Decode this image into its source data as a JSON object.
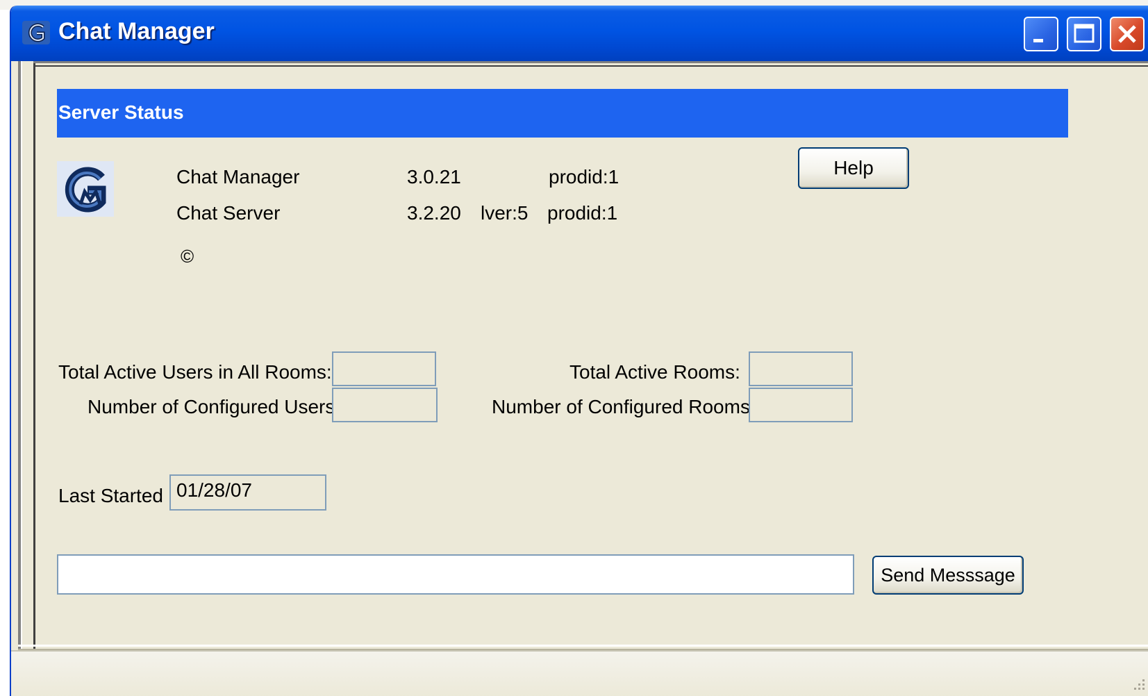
{
  "window": {
    "title": "Chat Manager",
    "icon": "chat-manager-logo-icon"
  },
  "header": {
    "title": "Server Status"
  },
  "products": [
    {
      "name": "Chat Manager",
      "version": "3.0.21",
      "lver": "",
      "prodid": "prodid:1"
    },
    {
      "name": "Chat Server",
      "version": "3.2.20",
      "lver": "lver:5",
      "prodid": "prodid:1"
    }
  ],
  "copyright_symbol": "©",
  "buttons": {
    "help": "Help",
    "send": "Send Messsage"
  },
  "stats": {
    "total_active_users_label": "Total Active Users in All Rooms:",
    "total_active_users_value": "",
    "configured_users_label": "Number of Configured Users:",
    "configured_users_value": "",
    "total_active_rooms_label": "Total Active Rooms:",
    "total_active_rooms_value": "",
    "configured_rooms_label": "Number of Configured Rooms:",
    "configured_rooms_value": ""
  },
  "last_started": {
    "label": "Last Started",
    "value": "01/28/07"
  },
  "message": {
    "value": ""
  },
  "colors": {
    "titlebar": "#0054e3",
    "header_bar": "#1e64f0",
    "window_bg": "#ece9d8",
    "close_button": "#d8492a"
  }
}
